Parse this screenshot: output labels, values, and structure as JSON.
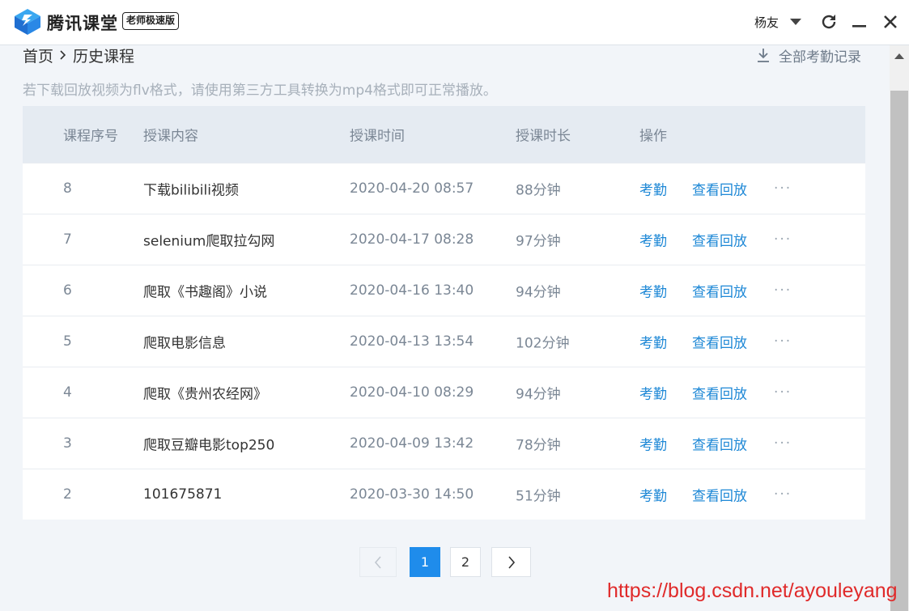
{
  "titlebar": {
    "app_name": "腾讯课堂",
    "edition_badge": "老师极速版",
    "user_name": "杨友"
  },
  "breadcrumb": {
    "home": "首页",
    "current": "历史课程"
  },
  "export_label": "全部考勤记录",
  "notice": "若下载回放视频为flv格式，请使用第三方工具转换为mp4格式即可正常播放。",
  "table": {
    "headers": {
      "no": "课程序号",
      "content": "授课内容",
      "time": "授课时间",
      "duration": "授课时长",
      "operation": "操作"
    },
    "rows": [
      {
        "no": "8",
        "content": "下载bilibili视频",
        "time": "2020-04-20 08:57",
        "duration": "88分钟"
      },
      {
        "no": "7",
        "content": "selenium爬取拉勾网",
        "time": "2020-04-17 08:28",
        "duration": "97分钟"
      },
      {
        "no": "6",
        "content": "爬取《书趣阁》小说",
        "time": "2020-04-16 13:40",
        "duration": "94分钟"
      },
      {
        "no": "5",
        "content": "爬取电影信息",
        "time": "2020-04-13 13:54",
        "duration": "102分钟"
      },
      {
        "no": "4",
        "content": "爬取《贵州农经网》",
        "time": "2020-04-10 08:29",
        "duration": "94分钟"
      },
      {
        "no": "3",
        "content": "爬取豆瓣电影top250",
        "time": "2020-04-09 13:42",
        "duration": "78分钟"
      },
      {
        "no": "2",
        "content": "101675871",
        "time": "2020-03-30 14:50",
        "duration": "51分钟"
      }
    ],
    "actions": {
      "attendance": "考勤",
      "replay": "查看回放",
      "more": "···"
    }
  },
  "pagination": {
    "pages": [
      "1",
      "2"
    ],
    "current": "1"
  },
  "watermark": "https://blog.csdn.net/ayouleyang",
  "colors": {
    "accent": "#1f8ceb",
    "link": "#1e88d6",
    "header_bg": "#e5ebf2",
    "page_bg": "#f2f5f9"
  },
  "icons": [
    "logo-icon",
    "chevron-down-icon",
    "refresh-icon",
    "minimize-icon",
    "close-icon",
    "chevron-right-icon",
    "download-icon",
    "chevron-left-icon",
    "more-icon",
    "scroll-up-icon"
  ]
}
